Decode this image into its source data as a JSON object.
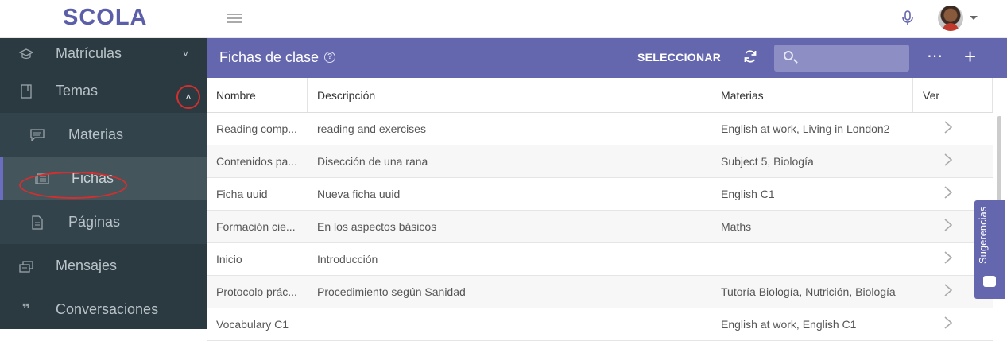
{
  "app": {
    "logo": "SCOLA"
  },
  "sidebar": {
    "items": [
      {
        "label": "Matrículas",
        "icon": "graduation-cap-icon",
        "chevron": "˅"
      },
      {
        "label": "Temas",
        "icon": "notebook-icon",
        "chevron": "˄"
      },
      {
        "label": "Materias",
        "icon": "comment-lines-icon"
      },
      {
        "label": "Fichas",
        "icon": "newspaper-icon"
      },
      {
        "label": "Páginas",
        "icon": "file-text-icon"
      },
      {
        "label": "Mensajes",
        "icon": "inbox-icon"
      },
      {
        "label": "Conversaciones",
        "icon": "quote-icon"
      }
    ]
  },
  "header": {
    "title": "Fichas de clase",
    "select_label": "SELECCIONAR",
    "search_placeholder": "",
    "more_label": "⋯",
    "add_label": "+"
  },
  "table": {
    "columns": [
      "Nombre",
      "Descripción",
      "Materias",
      "Ver"
    ],
    "rows": [
      {
        "nombre": "Reading comp...",
        "descripcion": "reading and exercises",
        "materias": "English at work, Living in London2"
      },
      {
        "nombre": "Contenidos pa...",
        "descripcion": "Disección de una rana",
        "materias": "Subject 5, Biología"
      },
      {
        "nombre": "Ficha uuid",
        "descripcion": "Nueva ficha uuid",
        "materias": "English C1"
      },
      {
        "nombre": "Formación cie...",
        "descripcion": "En los aspectos básicos",
        "materias": "Maths"
      },
      {
        "nombre": "Inicio",
        "descripcion": "Introducción",
        "materias": ""
      },
      {
        "nombre": "Protocolo prác...",
        "descripcion": "Procedimiento según Sanidad",
        "materias": "Tutoría Biología, Nutrición, Biología"
      },
      {
        "nombre": "Vocabulary C1",
        "descripcion": "",
        "materias": "English at work, English C1"
      }
    ]
  },
  "feedback": {
    "label": "Sugerencias"
  },
  "colors": {
    "brand": "#6466ae",
    "sidebar": "#2b3940",
    "highlight": "#d32f2f"
  }
}
